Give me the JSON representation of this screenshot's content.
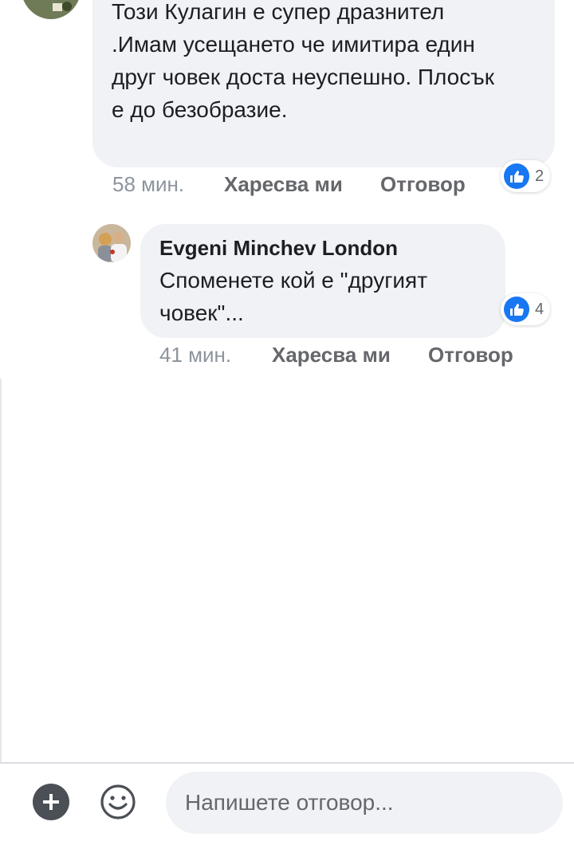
{
  "comments": [
    {
      "author": "",
      "text": "Този Кулагин е супер дразнител .Имам усещането че имитира един друг човек доста неуспешно. Плосък е до безобразие.",
      "time": "58 мин.",
      "like_label": "Харесва ми",
      "reply_label": "Отговор",
      "reaction_icon": "thumbs-up-icon",
      "reaction_count": "2"
    },
    {
      "author": "Evgeni Minchev London",
      "text": "Споменете кой е \"другият човек\"...",
      "time": "41 мин.",
      "like_label": "Харесва ми",
      "reply_label": "Отговор",
      "reaction_icon": "thumbs-up-icon",
      "reaction_count": "4"
    }
  ],
  "composer": {
    "add_icon": "plus-circle-icon",
    "emoji_icon": "smiley-icon",
    "placeholder": "Напишете отговор..."
  },
  "colors": {
    "bubble": "#f0f2f5",
    "like_blue": "#1877f2",
    "meta_gray": "#65676b"
  }
}
